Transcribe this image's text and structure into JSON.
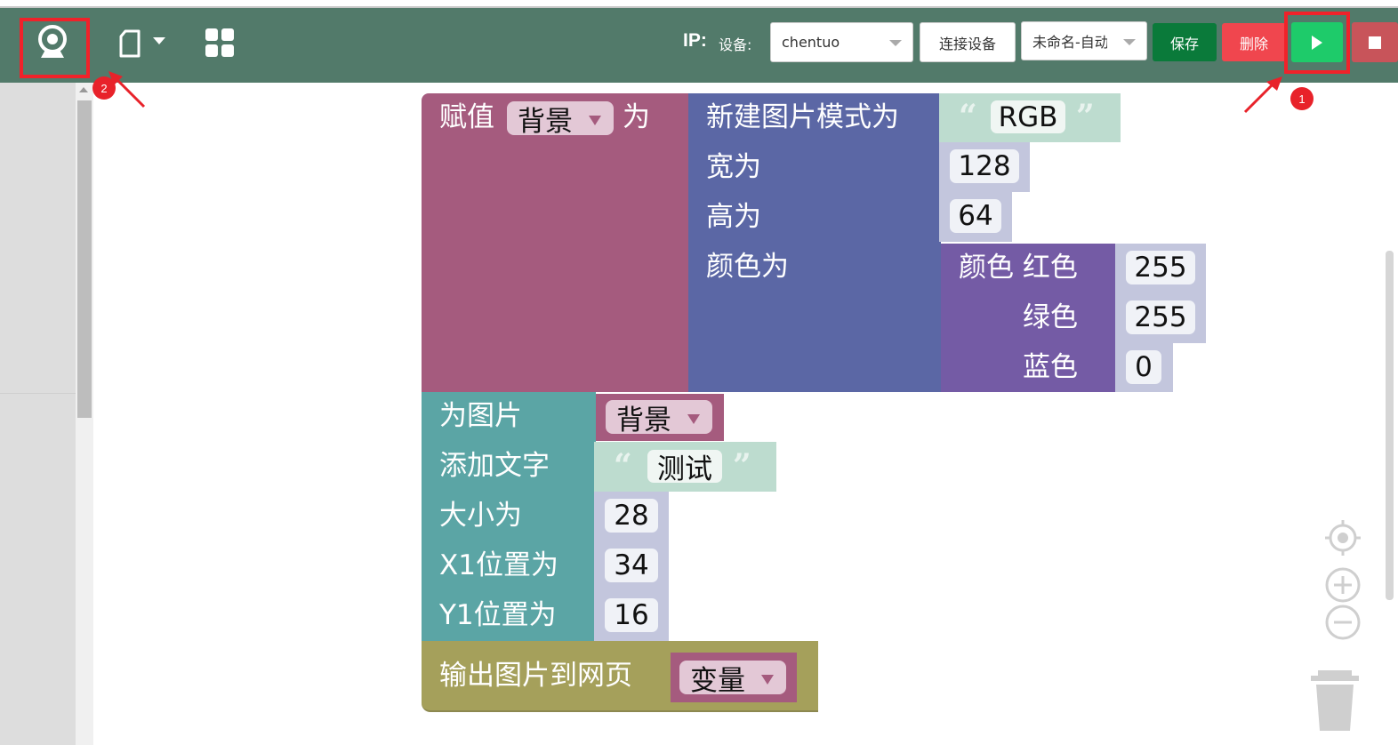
{
  "toolbar": {
    "ip_label": "IP:",
    "device_label": "设备:",
    "device_value": "chentuo",
    "connect_label": "连接设备",
    "project_value": "未命名-自动",
    "save_label": "保存",
    "delete_label": "删除",
    "icons": [
      "webcam-icon",
      "new-file-icon",
      "apps-grid-icon",
      "run-icon",
      "stop-icon"
    ]
  },
  "annotations": {
    "one": "1",
    "two": "2"
  },
  "colors": {
    "toolbar": "#527a6a",
    "save": "#0a7a3a",
    "delete": "#f0464e",
    "run": "#1ecb6a",
    "stop": "#c8545a",
    "variable_block": "#a55b7e",
    "image_block": "#5b67a5",
    "color_block": "#745ba5",
    "text_block": "#5ba5a5",
    "output_block": "#a5a05b"
  },
  "blocks": {
    "assign": {
      "label_set": "赋值",
      "var": "背景",
      "label_as": "为"
    },
    "new_image": {
      "label_mode": "新建图片模式为",
      "mode": "RGB",
      "label_width": "宽为",
      "width": "128",
      "label_height": "高为",
      "height": "64",
      "label_color": "颜色为"
    },
    "color": {
      "label_red": "颜色 红色",
      "red": "255",
      "label_green": "绿色",
      "green": "255",
      "label_blue": "蓝色",
      "blue": "0"
    },
    "add_text": {
      "label_for_image": "为图片",
      "image_var": "背景",
      "label_add_text": "添加文字",
      "text": "测试",
      "label_size": "大小为",
      "size": "28",
      "label_x1": "X1位置为",
      "x1": "34",
      "label_y1": "Y1位置为",
      "y1": "16"
    },
    "output": {
      "label": "输出图片到网页",
      "var": "变量"
    }
  }
}
